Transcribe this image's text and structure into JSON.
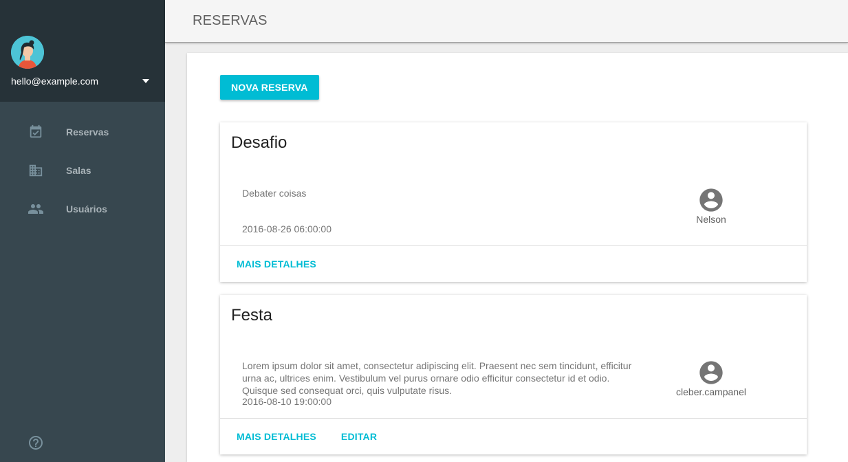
{
  "sidebar": {
    "user_email": "hello@example.com",
    "items": [
      {
        "label": "Reservas",
        "icon": "calendar-check-icon"
      },
      {
        "label": "Salas",
        "icon": "building-icon"
      },
      {
        "label": "Usuários",
        "icon": "people-icon"
      }
    ],
    "help_icon": "help-circle-icon"
  },
  "header": {
    "title": "RESERVAS"
  },
  "main": {
    "new_button_label": "NOVA RESERVA",
    "reservations": [
      {
        "title": "Desafio",
        "description": "Debater coisas",
        "datetime": "2016-08-26 06:00:00",
        "user": "Nelson",
        "actions": [
          "MAIS DETALHES"
        ]
      },
      {
        "title": "Festa",
        "description": "Lorem ipsum dolor sit amet, consectetur adipiscing elit. Praesent nec sem tincidunt, efficitur urna ac, ultrices enim. Vestibulum vel purus ornare odio efficitur consectetur id et odio. Quisque sed consequat orci, quis vulputate risus.",
        "datetime": "2016-08-10 19:00:00",
        "user": "cleber.campanel",
        "actions": [
          "MAIS DETALHES",
          "EDITAR"
        ]
      }
    ]
  },
  "colors": {
    "accent": "#00bcd4",
    "sidebar": "#37474f",
    "sidebar_header": "#263238"
  }
}
